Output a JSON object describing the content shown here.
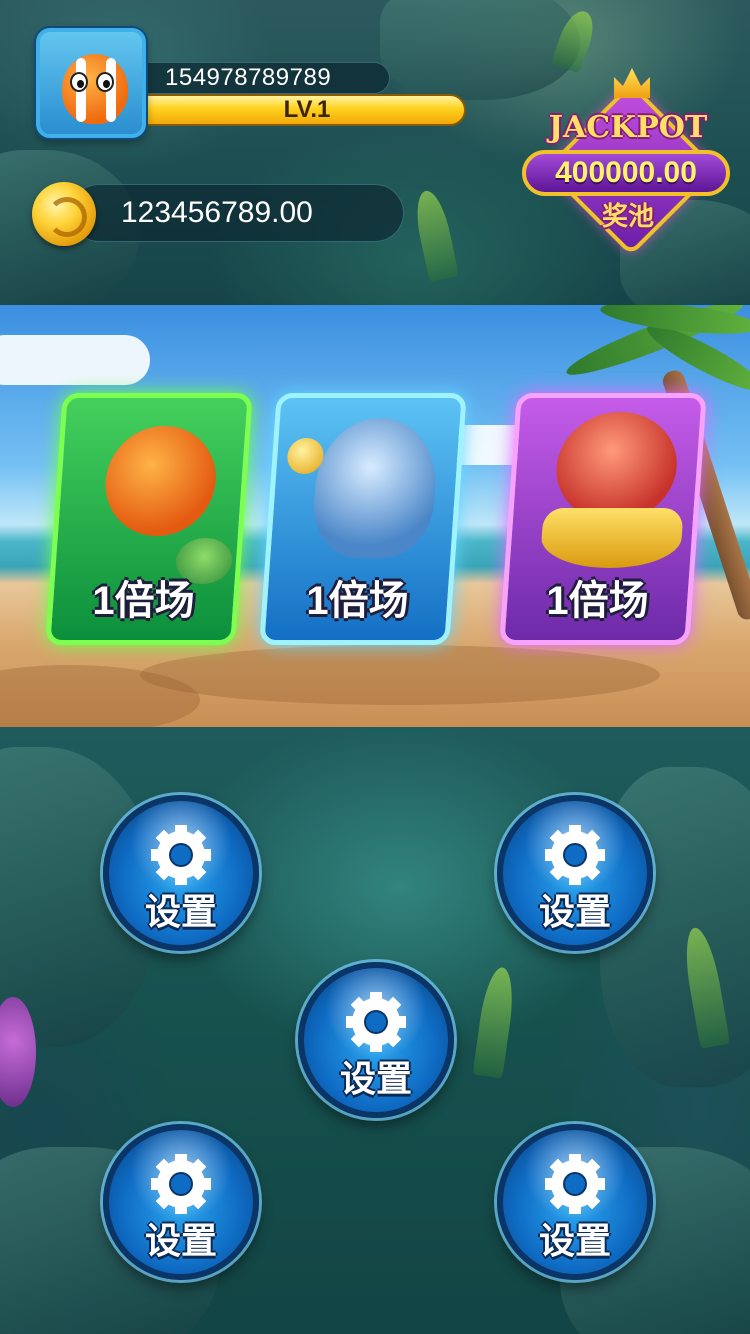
{
  "player": {
    "id": "154978789789",
    "level": "LV.1",
    "coins": "123456789.00"
  },
  "jackpot": {
    "title": "JACKPOT",
    "amount": "400000.00",
    "subtitle": "奖池"
  },
  "rooms": [
    {
      "label": "1倍场",
      "theme": "green",
      "color": "#45d05c",
      "creature": "anglerfish-icon"
    },
    {
      "label": "1倍场",
      "theme": "blue",
      "color": "#2c8fe0",
      "creature": "shark-icon"
    },
    {
      "label": "1倍场",
      "theme": "purple",
      "color": "#b04ee0",
      "creature": "octopus-icon"
    }
  ],
  "buttons": [
    {
      "label": "设置",
      "icon": "gear-icon"
    },
    {
      "label": "设置",
      "icon": "gear-icon"
    },
    {
      "label": "设置",
      "icon": "gear-icon"
    },
    {
      "label": "设置",
      "icon": "gear-icon"
    },
    {
      "label": "设置",
      "icon": "gear-icon"
    }
  ],
  "colors": {
    "level_bar": "#ffd21f",
    "button_blue": "#0f6cc4",
    "jackpot_purple": "#6a1fa8",
    "jackpot_gold": "#f2c02a"
  }
}
